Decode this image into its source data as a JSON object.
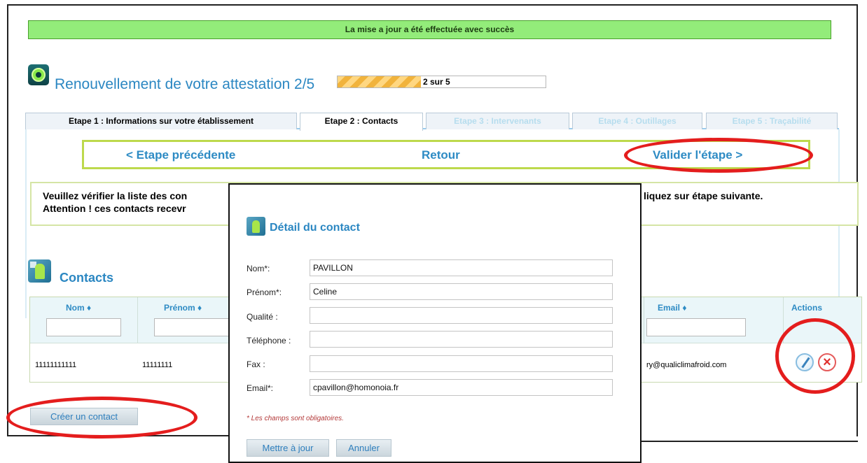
{
  "notification": {
    "message": "La mise a jour a été effectuée avec succès"
  },
  "header": {
    "title": "Renouvellement de votre attestation 2/5",
    "progress": {
      "value_fraction": 0.4,
      "label": "2 sur 5"
    }
  },
  "tabs": [
    {
      "label": "Etape 1 : Informations sur votre établissement",
      "state": "enabled"
    },
    {
      "label": "Etape 2 : Contacts",
      "state": "active"
    },
    {
      "label": "Etape 3 : Intervenants",
      "state": "disabled"
    },
    {
      "label": "Etape 4 : Outillages",
      "state": "disabled"
    },
    {
      "label": "Etape 5 : Traçabilité",
      "state": "disabled"
    }
  ],
  "step_nav": {
    "previous": "< Etape précédente",
    "back": "Retour",
    "validate": "Valider l'étape >"
  },
  "info": {
    "line1_left": "Veuillez vérifier la liste des con",
    "line1_right": "liquez sur étape suivante.",
    "line2_left": "Attention ! ces contacts recevr"
  },
  "contacts": {
    "title": "Contacts",
    "columns": {
      "nom": "Nom ♦",
      "prenom": "Prénom ♦",
      "email": "Email ♦",
      "actions": "Actions"
    },
    "rows": [
      {
        "nom": "11111111111",
        "prenom": "11111111",
        "email": "ry@qualiclimafroid.com"
      }
    ],
    "create_button": "Créer un contact"
  },
  "modal": {
    "title": "Détail du contact",
    "fields": {
      "nom": {
        "label": "Nom*:",
        "value": "PAVILLON"
      },
      "prenom": {
        "label": "Prénom*:",
        "value": "Celine"
      },
      "qualite": {
        "label": "Qualité :",
        "value": ""
      },
      "telephone": {
        "label": "Téléphone :",
        "value": ""
      },
      "fax": {
        "label": "Fax :",
        "value": ""
      },
      "email": {
        "label": "Email*:",
        "value": "cpavillon@homonoia.fr"
      }
    },
    "required_note": "* Les champs sont obligatoires.",
    "update_button": "Mettre à jour",
    "cancel_button": "Annuler"
  },
  "colors": {
    "success_bg": "#93ec7a",
    "title_blue": "#2b87c2",
    "nav_border": "#bdd94c",
    "annotation_red": "#e41d1d"
  }
}
